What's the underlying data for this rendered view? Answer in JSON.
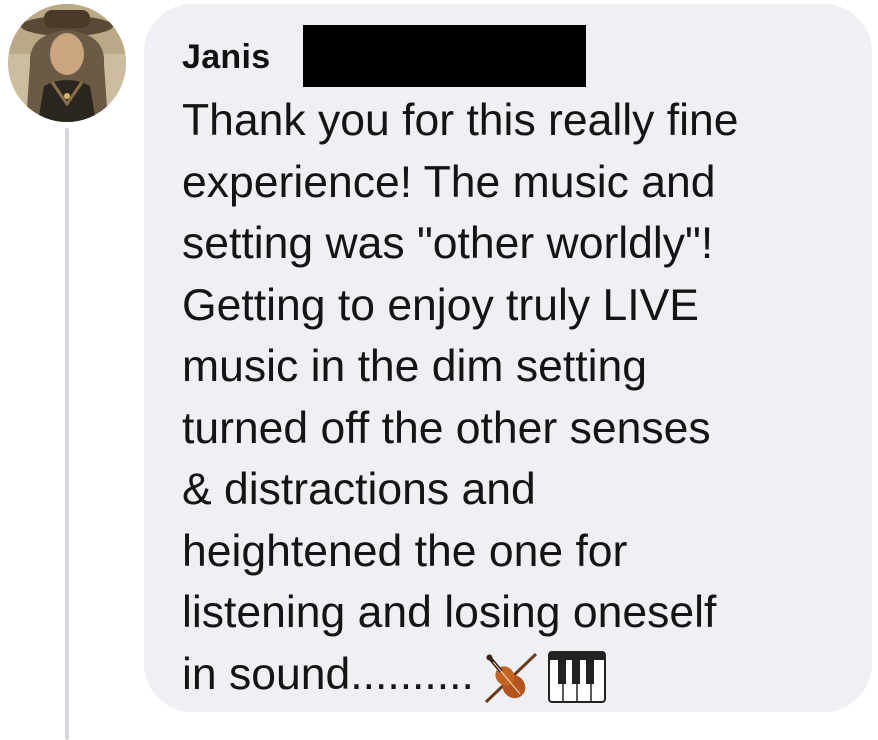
{
  "comment": {
    "author": "Janis",
    "author_avatar_icon": "user-avatar-photo",
    "author_redacted": true,
    "lines": [
      "Thank you for this really fine",
      "experience! The music and",
      "setting was \"other worldly\"!",
      "Getting to enjoy truly LIVE",
      "music in the dim setting",
      "turned off the other senses",
      "& distractions and",
      "heightened the one for",
      "listening and losing oneself",
      "in sound.........."
    ],
    "emojis": [
      "violin-emoji",
      "piano-keys-emoji"
    ]
  },
  "colors": {
    "bubble_background": "#eff0f4",
    "text": "#141414",
    "thread_line": "#d4d7dd",
    "redaction": "#000000"
  }
}
